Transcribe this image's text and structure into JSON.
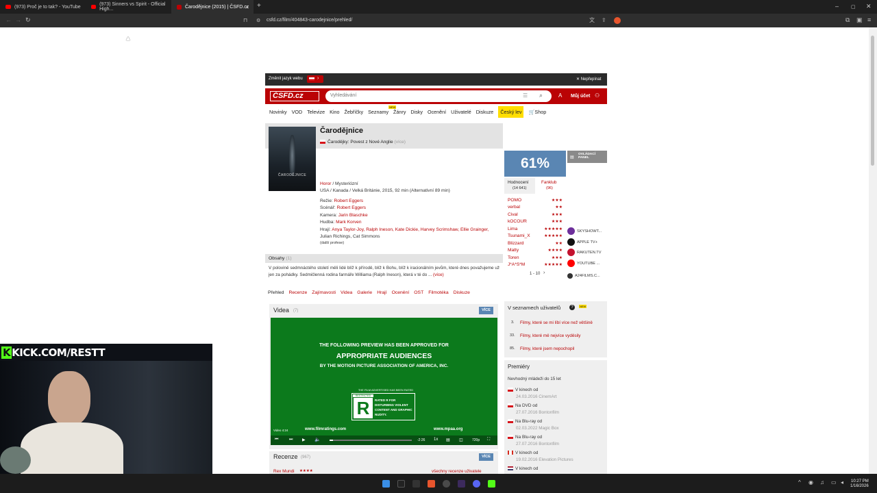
{
  "browser": {
    "tabs": [
      {
        "label": "(973) Proč je to tak? - YouTube"
      },
      {
        "label": "(973) Sinners vs Spirit - Official High..."
      },
      {
        "label": "Čarodějnice (2015) | ČSFD.cz"
      }
    ],
    "url": "csfd.cz/film/404843-carodejnice/prehled/"
  },
  "langbar": {
    "change_label": "Změnit jazyk webu",
    "close_label": "Nepřepínat"
  },
  "header": {
    "logo_text": "ČSFD.cz",
    "search_placeholder": "Vyhledávání",
    "account_label": "Můj účet"
  },
  "mainnav": [
    "Novinky",
    "VOD",
    "Televize",
    "Kino",
    "Žebříčky",
    "Seznamy",
    "Žánry",
    "Disky",
    "Ocenění",
    "Uživatelé",
    "Diskuze",
    "Český lev",
    "Shop"
  ],
  "mainnav_badge": "NEW",
  "film": {
    "title": "Čarodějnice",
    "alt_title": "Čarodějky: Povest z Nové Anglie",
    "alt_more": "(více)",
    "genre_first": "Horor",
    "genre_rest": "/ Mysteriózní",
    "origin": "USA / Kanada / Velká Británie, 2015, 92 min (Alternativní 89 min)",
    "credits": [
      {
        "role": "Režie:",
        "names": "Robert Eggers"
      },
      {
        "role": "Scénář:",
        "names": "Robert Eggers"
      },
      {
        "role": "Kamera:",
        "names": "Jarin Blaschke"
      },
      {
        "role": "Hudba:",
        "names": "Mark Korven"
      },
      {
        "role": "Hrají:",
        "names": "Anya Taylor-Joy, Ralph Ineson, Kate Dickie, Harvey Scrimshaw, Ellie Grainger,"
      }
    ],
    "credits_cont": "Julian Richings, Cat Simmons",
    "more_profs": "(další profese)",
    "poster_title": "ČARODĚJNICE"
  },
  "plot": {
    "label": "Obsahy",
    "count": "(1)",
    "text": "V polovině sedmnáctého století měli lidé blíž k přírodě, blíž k Bohu, blíž k iracionálním jevům, které dnes považujeme už jen za pohádky. Sedmičlenná rodina farmáře Williama (Ralph Ineson), která v té do ...",
    "more": "(více)"
  },
  "subnav": [
    "Přehled",
    "Recenze",
    "Zajímavosti",
    "Videa",
    "Galerie",
    "Hrají",
    "Ocenění",
    "OST",
    "Filmotéka",
    "Diskuze"
  ],
  "videos": {
    "title": "Videa",
    "count": "(7)",
    "more": "VÍCE",
    "preview_line1": "THE FOLLOWING PREVIEW HAS BEEN APPROVED FOR",
    "preview_line2": "APPROPRIATE AUDIENCES",
    "preview_line3": "BY THE MOTION PICTURE ASSOCIATION OF AMERICA, INC.",
    "rated_head": "THE FILM ADVERTISED HAS BEEN RATED",
    "rated_letter": "R",
    "restricted": "RESTRICTED",
    "rated_reason": "RATED R FOR DISTURBING VIOLENT CONTENT AND GRAPHIC NUDITY.",
    "site_left": "www.filmratings.com",
    "site_right": "www.mpaa.org",
    "corner_label": "Video 4:24",
    "time": "-2:26",
    "speed": "1x",
    "quality": "720p",
    "progress": 0.04
  },
  "reviews": {
    "title": "Recenze",
    "count": "(967)",
    "more": "VÍCE",
    "first_user": "Rex Mundi",
    "first_stars": "★★★★",
    "all_link": "všechny recenze uživatele"
  },
  "rating": {
    "percent": "61%",
    "tab_rating": "Hodnocení",
    "tab_rating_count": "(14 641)",
    "tab_fanclub": "Fanklub",
    "tab_fanclub_count": "(96)",
    "users": [
      {
        "name": "POMO",
        "stars": "★★★"
      },
      {
        "name": "verbal",
        "stars": "★★"
      },
      {
        "name": "Cival",
        "stars": "★★★"
      },
      {
        "name": "kOCOUR",
        "stars": "★★★"
      },
      {
        "name": "Lima",
        "stars": "★★★★★"
      },
      {
        "name": "Tsunami_X",
        "stars": "★★★★★"
      },
      {
        "name": "Blizzard",
        "stars": "★★"
      },
      {
        "name": "Matty",
        "stars": "★★★★"
      },
      {
        "name": "Toren",
        "stars": "★★★"
      },
      {
        "name": "J*A*S*M",
        "stars": "★★★★★"
      }
    ],
    "pager": "1 - 10"
  },
  "control_panel": "OVLÁDACÍ PANEL",
  "vod": [
    {
      "name": "SKYSHOWT...",
      "color": "#6d2f9b"
    },
    {
      "name": "APPLE TV+",
      "color": "#111111"
    },
    {
      "name": "RAKUTEN.TV",
      "color": "#c4122f"
    },
    {
      "name": "YOUTUBE ...",
      "color": "#ff0000"
    },
    {
      "name": "A24FILMS.C...",
      "color": "#333333"
    }
  ],
  "lists": {
    "title": "V seznamech uživatelů",
    "badge": "NEW",
    "items": [
      {
        "num": "3.",
        "label": "Filmy, které se mi líbí více než většině"
      },
      {
        "num": "33.",
        "label": "Filmy, které mě nejvíce vyděsily"
      },
      {
        "num": "85.",
        "label": "Filmy, které jsem nepochopil"
      }
    ]
  },
  "premieres": {
    "title": "Premiéry",
    "note": "Nevhodný mládeži do 15 let",
    "items": [
      {
        "label": "V kinech od",
        "sub": "24.03.2016 CinemArt"
      },
      {
        "label": "Na DVD od",
        "sub": "27.07.2016 Bontonfilm"
      },
      {
        "label": "Na Blu-ray od",
        "sub": "02.03.2022 Magic Box"
      },
      {
        "label": "Na Blu-ray od",
        "sub": "27.07.2016 Bontonfilm"
      },
      {
        "label": "V kinech od",
        "sub": "19.02.2016 Elevation Pictures"
      },
      {
        "label": "V kinech od",
        "sub": ""
      }
    ]
  },
  "webcam": {
    "overlay": "KICK.COM/RESTT"
  },
  "taskbar": {
    "time": "10:27 PM",
    "date": "1/16/2026"
  },
  "colors": {
    "csfd_red": "#ba0305",
    "rating_blue": "#5a86b3",
    "yellow": "#ffde00",
    "trailer_green": "#0c7a1c"
  }
}
